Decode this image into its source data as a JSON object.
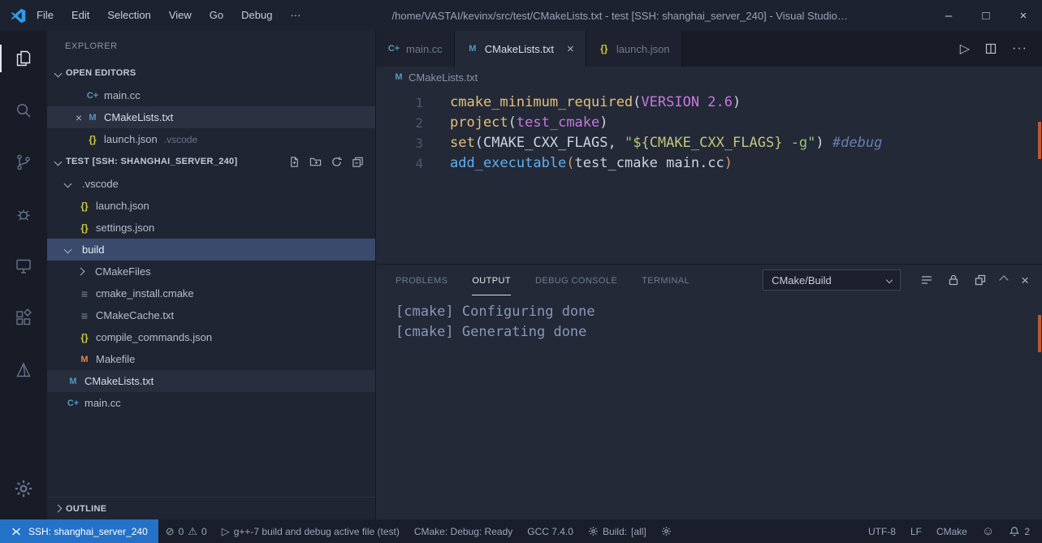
{
  "colors": {
    "accent_blue": "#2f81d6",
    "remote_badge_bg": "#2472c8",
    "selected_row_bg": "#394a6d",
    "editor_bg": "#232937",
    "sidebar_bg": "#202533",
    "statusbar_bg": "#191e2a",
    "syntax_function_yellow": "#e5c07b",
    "syntax_param_purple": "#c678dd",
    "syntax_string_green": "#98c379",
    "syntax_variable_yellow_green": "#c2c77b",
    "syntax_call_blue": "#61afef",
    "syntax_bracket_orange": "#d19a66",
    "syntax_comment_blue": "#6b7db3",
    "overview_marker_orange": "#c05a2e"
  },
  "icons": {
    "minimize": "–",
    "maximize": "□",
    "close": "×",
    "more": "···",
    "run": "▷",
    "smiley": "☺",
    "error": "⊘",
    "warning": "⚠"
  },
  "title_bar": {
    "menus": [
      "File",
      "Edit",
      "Selection",
      "View",
      "Go",
      "Debug",
      "···"
    ],
    "title": "/home/VASTAI/kevinx/src/test/CMakeLists.txt - test [SSH: shanghai_server_240] - Visual Studio…"
  },
  "sidebar": {
    "title": "EXPLORER",
    "open_editors": {
      "header": "OPEN EDITORS",
      "items": [
        {
          "label": "main.cc",
          "ic": "cpp",
          "icon_char": "C+"
        },
        {
          "label": "CMakeLists.txt",
          "ic": "cmake",
          "icon_char": "M",
          "state": "active",
          "close": "×"
        },
        {
          "label": "launch.json",
          "ic": "json",
          "icon_char": "{}",
          "detail": ".vscode"
        }
      ]
    },
    "tree_section": {
      "header": "TEST [SSH: SHANGHAI_SERVER_240]",
      "items": [
        {
          "label": ".vscode",
          "lvl": "0",
          "chev": "down"
        },
        {
          "label": "launch.json",
          "lvl": "1",
          "ic": "json",
          "icon_char": "{}"
        },
        {
          "label": "settings.json",
          "lvl": "1",
          "ic": "json",
          "icon_char": "{}"
        },
        {
          "label": "build",
          "lvl": "0",
          "chev": "down",
          "state": "selected"
        },
        {
          "label": "CMakeFiles",
          "lvl": "1",
          "chev": "right"
        },
        {
          "label": "cmake_install.cmake",
          "lvl": "1",
          "ic": "list",
          "icon_char": "≡"
        },
        {
          "label": "CMakeCache.txt",
          "lvl": "1",
          "ic": "list",
          "icon_char": "≡"
        },
        {
          "label": "compile_commands.json",
          "lvl": "1",
          "ic": "json",
          "icon_char": "{}"
        },
        {
          "label": "Makefile",
          "lvl": "1",
          "ic": "make",
          "icon_char": "M"
        },
        {
          "label": "CMakeLists.txt",
          "lvl": "0f",
          "ic": "cmake",
          "icon_char": "M",
          "state": "active"
        },
        {
          "label": "main.cc",
          "lvl": "0f",
          "ic": "cpp",
          "icon_char": "C+"
        }
      ]
    },
    "outline": {
      "header": "OUTLINE"
    }
  },
  "editor": {
    "tabs": [
      {
        "label": "main.cc",
        "ic": "cpp",
        "icon_char": "C+"
      },
      {
        "label": "CMakeLists.txt",
        "ic": "cmake",
        "icon_char": "M",
        "state": "active"
      },
      {
        "label": "launch.json",
        "ic": "json",
        "icon_char": "{}"
      }
    ],
    "breadcrumb": {
      "ic": "cmake",
      "icon_char": "M",
      "label": "CMakeLists.txt"
    },
    "lines": [
      {
        "num": "1",
        "segs": [
          {
            "t": "cmake_minimum_required",
            "c": "fn"
          },
          {
            "t": "(",
            "c": "df"
          },
          {
            "t": "VERSION 2.6",
            "c": "pm"
          },
          {
            "t": ")",
            "c": "df"
          }
        ]
      },
      {
        "num": "2",
        "segs": [
          {
            "t": "project",
            "c": "fn"
          },
          {
            "t": "(",
            "c": "df"
          },
          {
            "t": "test_cmake",
            "c": "pm"
          },
          {
            "t": ")",
            "c": "df"
          }
        ]
      },
      {
        "num": "3",
        "segs": [
          {
            "t": "set",
            "c": "fn"
          },
          {
            "t": "(",
            "c": "df"
          },
          {
            "t": "CMAKE_CXX_FLAGS, ",
            "c": "df"
          },
          {
            "t": "\"",
            "c": "st"
          },
          {
            "t": "${CMAKE_CXX_FLAGS}",
            "c": "vr"
          },
          {
            "t": " -g\"",
            "c": "st"
          },
          {
            "t": ") ",
            "c": "df"
          },
          {
            "t": "#debug",
            "c": "cm"
          }
        ]
      },
      {
        "num": "4",
        "segs": [
          {
            "t": "add_executable",
            "c": "bl"
          },
          {
            "t": "(",
            "c": "or"
          },
          {
            "t": "test_cmake main.cc",
            "c": "df"
          },
          {
            "t": ")",
            "c": "or"
          }
        ]
      }
    ]
  },
  "panel": {
    "tabs": [
      {
        "label": "PROBLEMS"
      },
      {
        "label": "OUTPUT",
        "state": "active"
      },
      {
        "label": "DEBUG CONSOLE"
      },
      {
        "label": "TERMINAL"
      }
    ],
    "channel_dropdown": "CMake/Build",
    "output_lines": [
      "[cmake] Configuring done",
      "[cmake] Generating done"
    ]
  },
  "status_bar": {
    "remote_label": "SSH: shanghai_server_240",
    "error_count": "0",
    "warning_count": "0",
    "launch_label": "g++-7 build and debug active file (test)",
    "cmake_status": "CMake: Debug: Ready",
    "compiler": "GCC 7.4.0",
    "build_label": "Build:",
    "build_target": "[all]",
    "encoding": "UTF-8",
    "eol": "LF",
    "language": "CMake",
    "notification_count": "2"
  }
}
